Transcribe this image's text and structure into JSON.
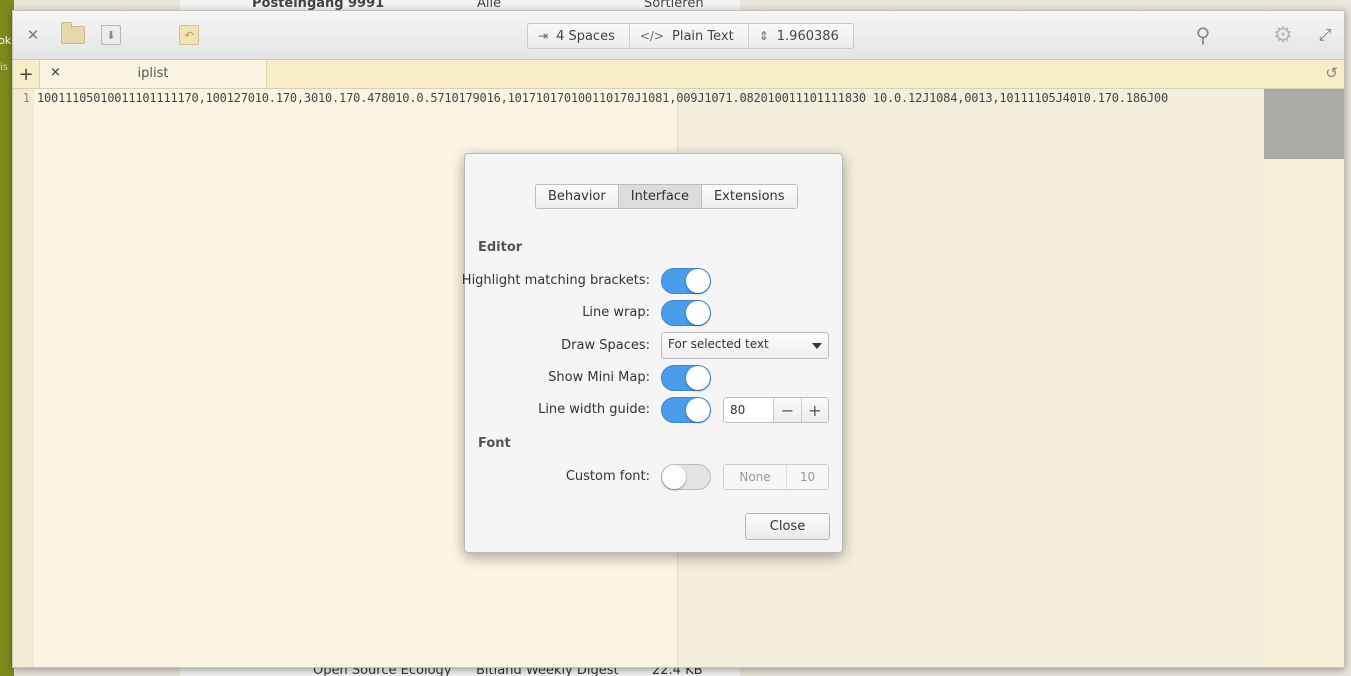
{
  "background": {
    "left_text": "ok",
    "left_text2": "is",
    "top_items": [
      "Posteingang",
      "9991",
      "Alle",
      "Sortieren"
    ],
    "bottom_items": [
      "Open Source Ecology",
      "Bitland Weekly Digest",
      "22.4 KB"
    ]
  },
  "headerbar": {
    "close_icon": "close-icon",
    "open_icon": "folder-icon",
    "save_icon": "save-icon",
    "revert_icon": "revert-icon",
    "indent_label": "4 Spaces",
    "language_label": "Plain Text",
    "position_label": "1.960386",
    "search_icon": "search-icon",
    "gear_icon": "gear-icon",
    "expand_icon": "expand-icon"
  },
  "tabs": {
    "add_label": "+",
    "items": [
      {
        "close": "×",
        "label": "iplist"
      }
    ],
    "history_icon": "history-icon"
  },
  "editor": {
    "line_number": "1",
    "content": "10011105010011101111170,100127010.170,3010.170.478010.0.5710179016,101710170100110170J1081,009J1071.082010011101111830 10.0.12J1084,0013,10111105J4010.170.186J00"
  },
  "dialog": {
    "tabs": [
      "Behavior",
      "Interface",
      "Extensions"
    ],
    "active_tab": "Interface",
    "editor_section": "Editor",
    "highlight_label": "Highlight matching brackets:",
    "highlight_on": true,
    "linewrap_label": "Line wrap:",
    "linewrap_on": true,
    "drawspaces_label": "Draw Spaces:",
    "drawspaces_value": "For selected text",
    "minimap_label": "Show Mini Map:",
    "minimap_on": true,
    "linewidth_label": "Line width guide:",
    "linewidth_on": true,
    "linewidth_value": "80",
    "minus": "−",
    "plus": "+",
    "font_section": "Font",
    "customfont_label": "Custom font:",
    "customfont_on": false,
    "font_name": "None",
    "font_size": "10",
    "close_label": "Close"
  },
  "colors": {
    "accent": "#4a9bea",
    "editor_bg": "#fcf5e3",
    "tabbar_bg": "#f8edc9"
  }
}
